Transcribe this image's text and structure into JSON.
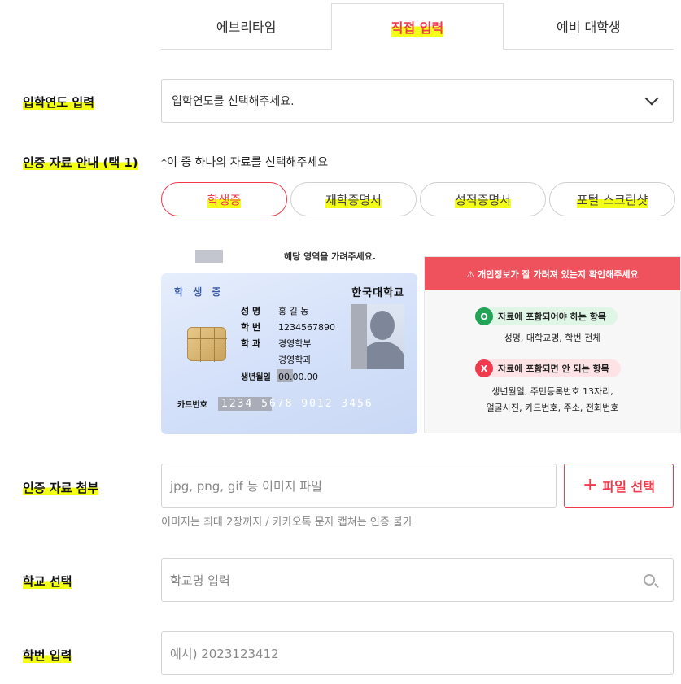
{
  "tabs": [
    {
      "label": "에브리타임"
    },
    {
      "label": "직접 입력"
    },
    {
      "label": "예비 대학생"
    }
  ],
  "year": {
    "label": "입학연도 입력",
    "placeholder": "입학연도를 선택해주세요."
  },
  "docs": {
    "label": "인증 자료 안내 (택 1)",
    "note": "*이 중 하나의 자료를 선택해주세요",
    "options": [
      {
        "label": "학생증"
      },
      {
        "label": "재학증명서"
      },
      {
        "label": "성적증명서"
      },
      {
        "label": "포털 스크린샷"
      }
    ]
  },
  "card": {
    "hint": "해당 영역을 가려주세요.",
    "title": "학 생 증",
    "school": "한국대학교",
    "name_k": "성 명",
    "name_v": "홍 길 동",
    "id_k": "학 번",
    "id_v": "1234567890",
    "dept_k": "학 과",
    "dept_v1": "경영학부",
    "dept_v2": "경영학과",
    "dob_k": "생년월일",
    "dob_v": "00.00.00",
    "cardno_k": "카드번호",
    "cardno_v": "1234 5678 9012 3456"
  },
  "warning": {
    "header": "⚠ 개인정보가 잘 가려져 있는지 확인해주세요",
    "ok_mark": "O",
    "ok_title": "자료에 포함되어야 하는 항목",
    "ok_text": "성명, 대학교명, 학번 전체",
    "no_mark": "X",
    "no_title": "자료에 포함되면 안 되는 항목",
    "no_text1": "생년월일, 주민등록번호 13자리,",
    "no_text2": "얼굴사진, 카드번호, 주소, 전화번호"
  },
  "attach": {
    "label": "인증 자료 첨부",
    "placeholder": "jpg, png, gif 등 이미지 파일",
    "button": "파일 선택",
    "helper": "이미지는 최대 2장까지 / 카카오톡 문자 캡쳐는 인증 불가"
  },
  "school": {
    "label": "학교 선택",
    "placeholder": "학교명 입력"
  },
  "student_id": {
    "label": "학번 입력",
    "placeholder": "예시) 2023123412"
  }
}
